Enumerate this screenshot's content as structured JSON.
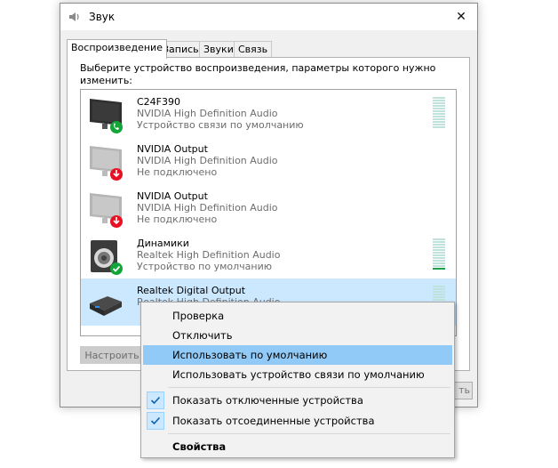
{
  "window": {
    "title": "Звук",
    "close_glyph": "✕"
  },
  "tabs": [
    {
      "label": "Воспроизведение",
      "active": true
    },
    {
      "label": "Запись"
    },
    {
      "label": "Звуки"
    },
    {
      "label": "Связь"
    }
  ],
  "prompt": "Выберите устройство воспроизведения, параметры которого нужно изменить:",
  "devices": [
    {
      "name": "C24F390",
      "driver": "NVIDIA High Definition Audio",
      "status": "Устройство связи по умолчанию",
      "icon": "monitor-icon",
      "badge": "phone-badge-icon",
      "meter_level": 0
    },
    {
      "name": "NVIDIA Output",
      "driver": "NVIDIA High Definition Audio",
      "status": "Не подключено",
      "icon": "monitor-icon",
      "badge": "disconnected-badge-icon"
    },
    {
      "name": "NVIDIA Output",
      "driver": "NVIDIA High Definition Audio",
      "status": "Не подключено",
      "icon": "monitor-icon",
      "badge": "disconnected-badge-icon"
    },
    {
      "name": "Динамики",
      "driver": "Realtek High Definition Audio",
      "status": "Устройство по умолчанию",
      "icon": "speaker-icon",
      "badge": "default-check-badge-icon",
      "meter_level": 0.08
    },
    {
      "name": "Realtek Digital Output",
      "driver": "Realtek High Definition Audio",
      "status": "",
      "icon": "digital-output-icon",
      "selected": true,
      "meter_level": 0
    }
  ],
  "buttons": {
    "configure": "Настроить",
    "apply_fragment": "ть"
  },
  "context_menu": {
    "items": [
      {
        "label": "Проверка"
      },
      {
        "label": "Отключить"
      },
      {
        "label": "Использовать по умолчанию",
        "highlighted": true
      },
      {
        "label": "Использовать устройство связи по умолчанию"
      },
      {
        "label": "Показать отключенные устройства",
        "checked": true
      },
      {
        "label": "Показать отсоединенные устройства",
        "checked": true
      },
      {
        "label": "Свойства",
        "bold": true
      }
    ]
  },
  "colors": {
    "selection": "#cce8ff",
    "menu_highlight": "#91c9f7",
    "meter_on": "#19a34a",
    "meter_off": "#bfe3dc",
    "default_badge": "#13a538",
    "disconnected_badge": "#e81123"
  }
}
